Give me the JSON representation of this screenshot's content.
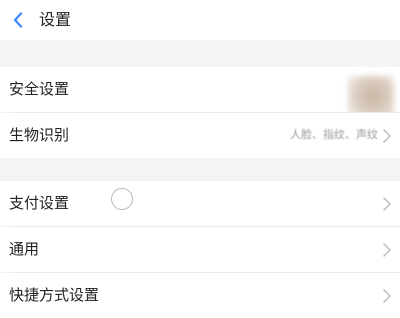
{
  "header": {
    "title": "设置"
  },
  "rows": [
    {
      "label": "安全设置",
      "value": ""
    },
    {
      "label": "生物识别",
      "value": "人脸、指纹、声纹"
    },
    {
      "label": "支付设置",
      "value": ""
    },
    {
      "label": "通用",
      "value": ""
    },
    {
      "label": "快捷方式设置",
      "value": ""
    }
  ],
  "colors": {
    "accent": "#3a86ff",
    "background": "#f4f4f6",
    "row_bg": "#ffffff",
    "chevron": "#c4c4c4"
  }
}
